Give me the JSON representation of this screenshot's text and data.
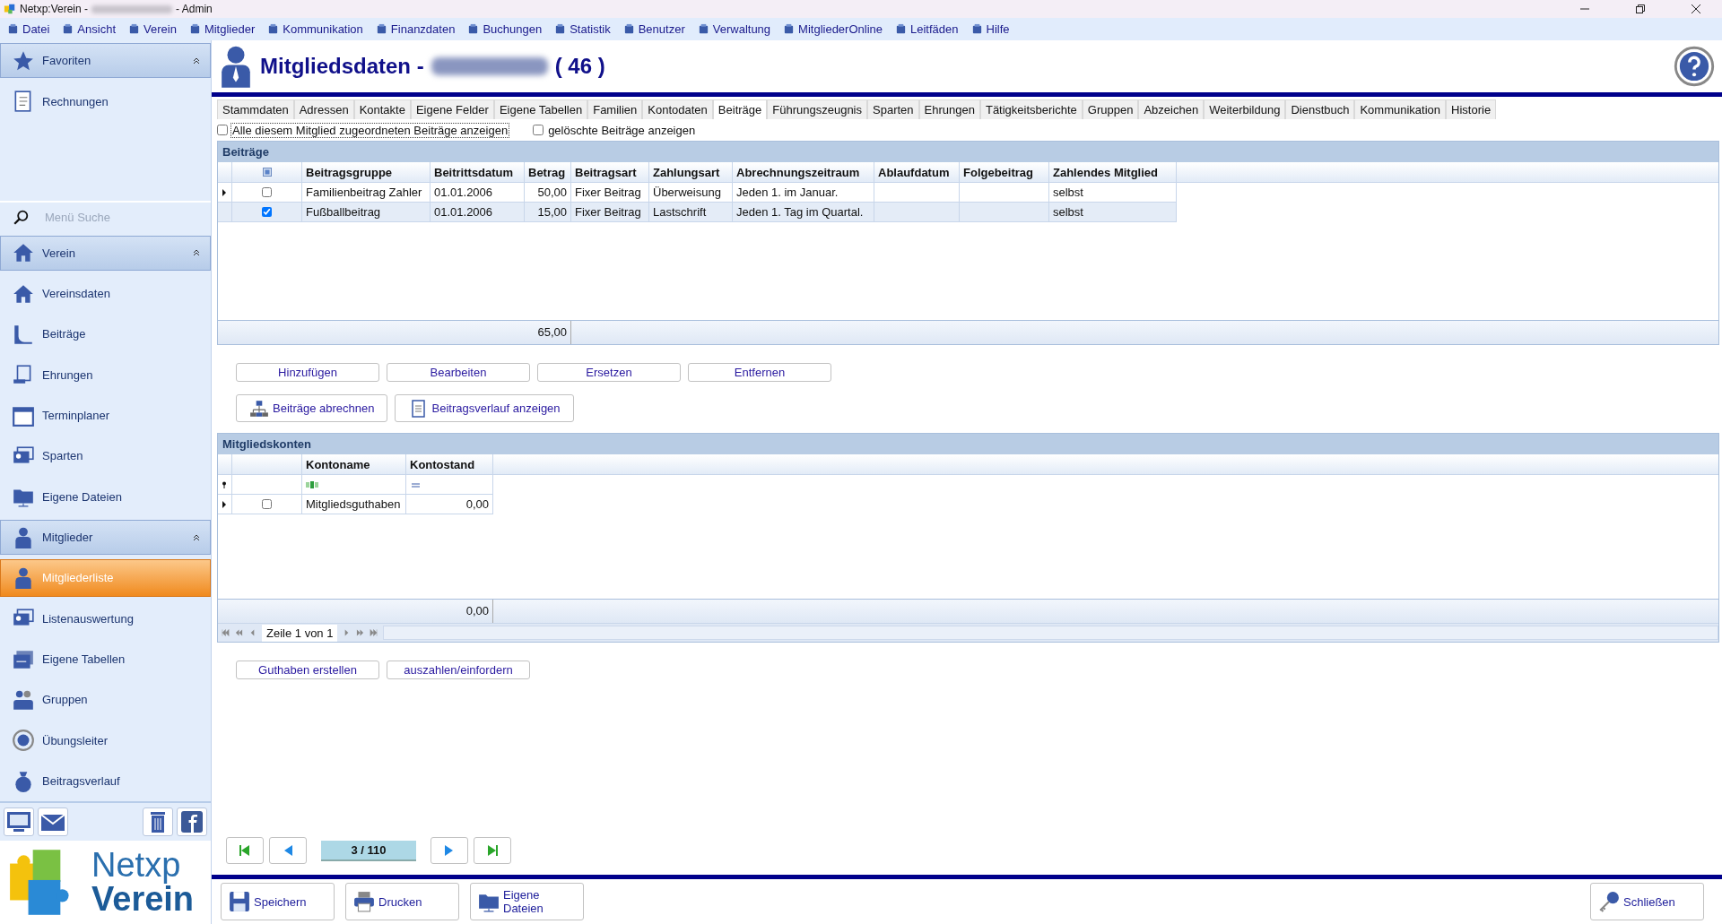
{
  "window": {
    "title_prefix": "Netxp:Verein -",
    "title_suffix": "- Admin"
  },
  "menu": [
    "Datei",
    "Ansicht",
    "Verein",
    "Mitglieder",
    "Kommunikation",
    "Finanzdaten",
    "Buchungen",
    "Statistik",
    "Benutzer",
    "Verwaltung",
    "MitgliederOnline",
    "Leitfäden",
    "Hilfe"
  ],
  "sidebar": {
    "search_placeholder": "Menü Suche",
    "groups": [
      {
        "label": "Favoriten",
        "expanded": true,
        "items": [
          {
            "label": "Rechnungen",
            "selected": false
          }
        ]
      },
      {
        "label": "Verein",
        "expanded": true,
        "items": [
          {
            "label": "Vereinsdaten",
            "selected": false
          },
          {
            "label": "Beiträge",
            "selected": false
          },
          {
            "label": "Ehrungen",
            "selected": false
          },
          {
            "label": "Terminplaner",
            "selected": false
          },
          {
            "label": "Sparten",
            "selected": false
          },
          {
            "label": "Eigene Dateien",
            "selected": false
          }
        ]
      },
      {
        "label": "Mitglieder",
        "expanded": true,
        "items": [
          {
            "label": "Mitgliederliste",
            "selected": true
          },
          {
            "label": "Listenauswertung",
            "selected": false
          },
          {
            "label": "Eigene Tabellen",
            "selected": false
          },
          {
            "label": "Gruppen",
            "selected": false
          },
          {
            "label": "Übungsleiter",
            "selected": false
          },
          {
            "label": "Beitragsverlauf",
            "selected": false
          }
        ]
      }
    ],
    "logo": [
      "Netxp",
      "Verein"
    ]
  },
  "header": {
    "title": "Mitgliedsdaten -",
    "count": "( 46 )"
  },
  "tabs": [
    {
      "label": "Stammdaten",
      "selected": false
    },
    {
      "label": "Adressen",
      "selected": false
    },
    {
      "label": "Kontakte",
      "selected": false
    },
    {
      "label": "Eigene Felder",
      "selected": false
    },
    {
      "label": "Eigene Tabellen",
      "selected": false
    },
    {
      "label": "Familien",
      "selected": false
    },
    {
      "label": "Kontodaten",
      "selected": false
    },
    {
      "label": "Beiträge",
      "selected": true
    },
    {
      "label": "Führungszeugnis",
      "selected": false
    },
    {
      "label": "Sparten",
      "selected": false
    },
    {
      "label": "Ehrungen",
      "selected": false
    },
    {
      "label": "Tätigkeitsberichte",
      "selected": false
    },
    {
      "label": "Gruppen",
      "selected": false
    },
    {
      "label": "Abzeichen",
      "selected": false
    },
    {
      "label": "Weiterbildung",
      "selected": false
    },
    {
      "label": "Dienstbuch",
      "selected": false
    },
    {
      "label": "Kommunikation",
      "selected": false
    },
    {
      "label": "Historie",
      "selected": false
    }
  ],
  "options": [
    {
      "label": "Alle diesem Mitglied zugeordneten Beiträge anzeigen",
      "checked": false,
      "focused": true
    },
    {
      "label": "gelöschte Beiträge anzeigen",
      "checked": false,
      "focused": false
    }
  ],
  "beitraege": {
    "title": "Beiträge",
    "select_all_indeterminate": true,
    "columns": [
      "Beitragsgruppe",
      "Beitrittsdatum",
      "Betrag",
      "Beitragsart",
      "Zahlungsart",
      "Abrechnungszeitraum",
      "Ablaufdatum",
      "Folgebeitrag",
      "Zahlendes Mitglied"
    ],
    "rows": [
      {
        "current": true,
        "selected": false,
        "checked": false,
        "cells": [
          "Familienbeitrag Zahler",
          "01.01.2006",
          "50,00",
          "Fixer Beitrag",
          "Überweisung",
          "Jeden 1. im Januar.",
          "",
          "",
          "selbst"
        ]
      },
      {
        "current": false,
        "selected": true,
        "checked": true,
        "cells": [
          "Fußballbeitrag",
          "01.01.2006",
          "15,00",
          "Fixer Beitrag",
          "Lastschrift",
          "Jeden 1. Tag im Quartal.",
          "",
          "",
          "selbst"
        ]
      }
    ],
    "total": "65,00"
  },
  "beitraege_buttons": [
    "Hinzufügen",
    "Bearbeiten",
    "Ersetzen",
    "Entfernen"
  ],
  "beitraege_actions": [
    "Beiträge abrechnen",
    "Beitragsverlauf anzeigen"
  ],
  "konten": {
    "title": "Mitgliedskonten",
    "columns": [
      "Kontoname",
      "Kontostand"
    ],
    "rows": [
      {
        "current": true,
        "selected": false,
        "checked": false,
        "cells": [
          "Mitgliedsguthaben",
          "0,00"
        ]
      }
    ],
    "total": "0,00",
    "pager": "Zeile 1 von 1"
  },
  "konten_buttons": [
    "Guthaben erstellen",
    "auszahlen/einfordern"
  ],
  "record_position": "3 / 110",
  "footer_buttons": [
    "Speichern",
    "Drucken",
    "Eigene Dateien"
  ],
  "close_button": "Schließen"
}
